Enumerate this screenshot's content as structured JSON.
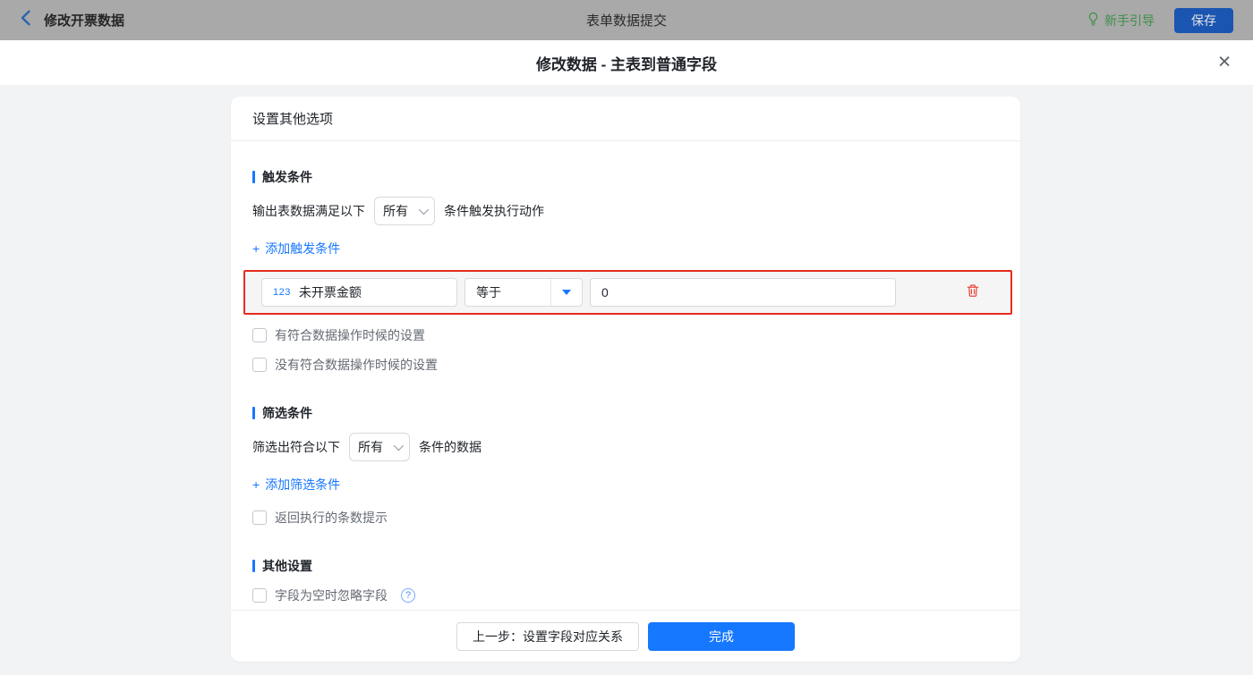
{
  "topbar": {
    "back_label": "修改开票数据",
    "title": "表单数据提交",
    "guide_label": "新手引导",
    "save_label": "保存"
  },
  "modal": {
    "title": "修改数据 - 主表到普通字段",
    "close_glyph": "✕"
  },
  "panel": {
    "header": "设置其他选项",
    "plus": "+",
    "trigger_section": {
      "title": "触发条件",
      "sentence_prefix": "输出表数据满足以下",
      "select_value": "所有",
      "sentence_suffix": "条件触发执行动作",
      "add_label": "添加触发条件",
      "condition": {
        "field_type_badge": "123",
        "field_name": "未开票金额",
        "operator": "等于",
        "value": "0"
      },
      "checkbox_1": "有符合数据操作时候的设置",
      "checkbox_2": "没有符合数据操作时候的设置"
    },
    "filter_section": {
      "title": "筛选条件",
      "sentence_prefix": "筛选出符合以下",
      "select_value": "所有",
      "sentence_suffix": "条件的数据",
      "add_label": "添加筛选条件",
      "checkbox_1": "返回执行的条数提示"
    },
    "other_section": {
      "title": "其他设置",
      "checkbox_1": "字段为空时忽略字段",
      "help_glyph": "?"
    },
    "footer": {
      "prev_label": "上一步：设置字段对应关系",
      "done_label": "完成"
    }
  },
  "colors": {
    "accent_blue": "#1677ff",
    "highlight_red": "#e62c1e",
    "guide_green": "#3e8f47",
    "topbar_dimmed": "#a9a9a9",
    "page_bg": "#f2f3f5"
  }
}
